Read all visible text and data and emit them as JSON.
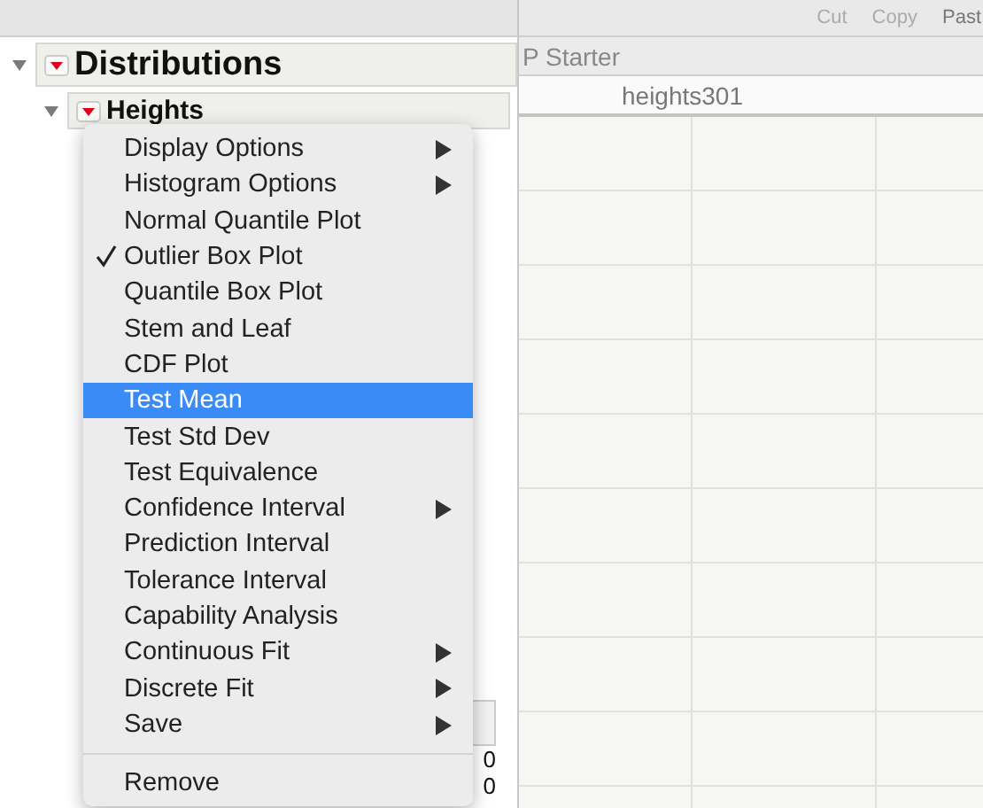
{
  "report": {
    "title": "Distributions",
    "expanded": true,
    "children": [
      {
        "title": "Heights",
        "expanded": true
      }
    ]
  },
  "menu": {
    "items": [
      {
        "label": "Display Options",
        "checked": false,
        "submenu": true,
        "selected": false
      },
      {
        "label": "Histogram Options",
        "checked": false,
        "submenu": true,
        "selected": false
      },
      {
        "label": "Normal Quantile Plot",
        "checked": false,
        "submenu": false,
        "selected": false
      },
      {
        "label": "Outlier Box Plot",
        "checked": true,
        "submenu": false,
        "selected": false
      },
      {
        "label": "Quantile Box Plot",
        "checked": false,
        "submenu": false,
        "selected": false
      },
      {
        "label": "Stem and Leaf",
        "checked": false,
        "submenu": false,
        "selected": false
      },
      {
        "label": "CDF Plot",
        "checked": false,
        "submenu": false,
        "selected": false
      },
      {
        "label": "Test Mean",
        "checked": false,
        "submenu": false,
        "selected": true
      },
      {
        "label": "Test Std Dev",
        "checked": false,
        "submenu": false,
        "selected": false
      },
      {
        "label": "Test Equivalence",
        "checked": false,
        "submenu": false,
        "selected": false
      },
      {
        "label": "Confidence Interval",
        "checked": false,
        "submenu": true,
        "selected": false
      },
      {
        "label": "Prediction Interval",
        "checked": false,
        "submenu": false,
        "selected": false
      },
      {
        "label": "Tolerance Interval",
        "checked": false,
        "submenu": false,
        "selected": false
      },
      {
        "label": "Capability Analysis",
        "checked": false,
        "submenu": false,
        "selected": false
      },
      {
        "label": "Continuous Fit",
        "checked": false,
        "submenu": true,
        "selected": false
      },
      {
        "label": "Discrete Fit",
        "checked": false,
        "submenu": true,
        "selected": false
      },
      {
        "label": "Save",
        "checked": false,
        "submenu": true,
        "selected": false
      }
    ],
    "footer_items": [
      {
        "label": "Remove",
        "selected": false
      }
    ]
  },
  "partial_values": [
    "0",
    "0"
  ],
  "data_window": {
    "toolbar": [
      "Cut",
      "Copy",
      "Past"
    ],
    "title": "P Starter",
    "table_title": "heights301"
  }
}
